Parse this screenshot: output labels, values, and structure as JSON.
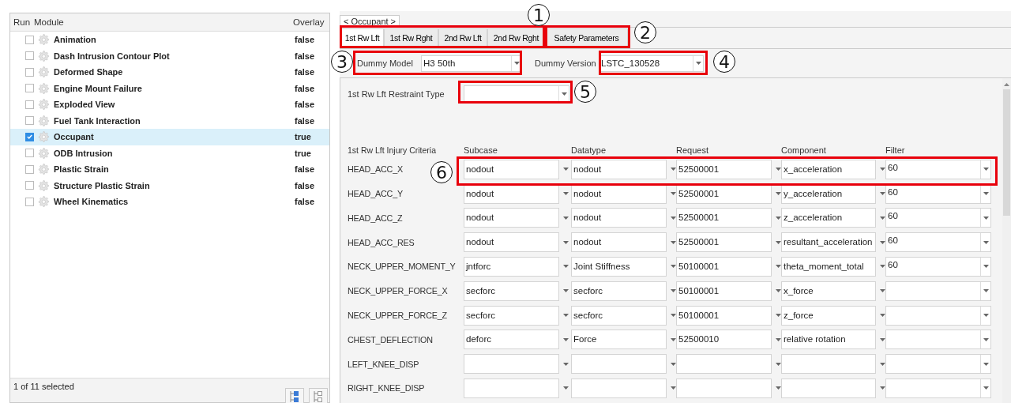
{
  "modules": {
    "columns": [
      "Run",
      "Module",
      "Overlay"
    ],
    "rows": [
      {
        "name": "Animation",
        "overlay": "false",
        "checked": false,
        "selected": false
      },
      {
        "name": "Dash Intrusion Contour Plot",
        "overlay": "false",
        "checked": false,
        "selected": false
      },
      {
        "name": "Deformed Shape",
        "overlay": "false",
        "checked": false,
        "selected": false
      },
      {
        "name": "Engine Mount Failure",
        "overlay": "false",
        "checked": false,
        "selected": false
      },
      {
        "name": "Exploded View",
        "overlay": "false",
        "checked": false,
        "selected": false
      },
      {
        "name": "Fuel Tank Interaction",
        "overlay": "false",
        "checked": false,
        "selected": false
      },
      {
        "name": "Occupant",
        "overlay": "true",
        "checked": true,
        "selected": true
      },
      {
        "name": "ODB Intrusion",
        "overlay": "true",
        "checked": false,
        "selected": false
      },
      {
        "name": "Plastic Strain",
        "overlay": "false",
        "checked": false,
        "selected": false
      },
      {
        "name": "Structure Plastic Strain",
        "overlay": "false",
        "checked": false,
        "selected": false
      },
      {
        "name": "Wheel Kinematics",
        "overlay": "false",
        "checked": false,
        "selected": false
      }
    ],
    "status": "1 of 11 selected"
  },
  "module_tab": "< Occupant >",
  "tabs": [
    {
      "label": "1st Rw Lft",
      "selected": true
    },
    {
      "label": "1st Rw Rght",
      "selected": false
    },
    {
      "label": "2nd Rw Lft",
      "selected": false
    },
    {
      "label": "2nd Rw Rght",
      "selected": false
    },
    {
      "label": "Safety Parameters",
      "selected": false
    }
  ],
  "dummy_model": {
    "label": "Dummy Model",
    "value": "H3 50th"
  },
  "dummy_version": {
    "label": "Dummy Version",
    "value": "LSTC_130528"
  },
  "restraint_type": {
    "label": "1st Rw Lft Restraint Type"
  },
  "criteria": {
    "title": "1st Rw Lft Injury Criteria",
    "columns": [
      "Subcase",
      "Datatype",
      "Request",
      "Component",
      "Filter"
    ],
    "rows": [
      {
        "name": "HEAD_ACC_X",
        "cells": [
          {
            "value": "nodout"
          },
          {
            "value": "nodout"
          },
          {
            "value": "52500001"
          },
          {
            "value": "x_acceleration"
          },
          {
            "value": "60"
          }
        ]
      },
      {
        "name": "HEAD_ACC_Y",
        "cells": [
          {
            "value": "nodout"
          },
          {
            "value": "nodout"
          },
          {
            "value": "52500001"
          },
          {
            "value": "y_acceleration"
          },
          {
            "value": "60"
          }
        ]
      },
      {
        "name": "HEAD_ACC_Z",
        "cells": [
          {
            "value": "nodout"
          },
          {
            "value": "nodout"
          },
          {
            "value": "52500001"
          },
          {
            "value": "z_acceleration"
          },
          {
            "value": "60"
          }
        ]
      },
      {
        "name": "HEAD_ACC_RES",
        "cells": [
          {
            "value": "nodout"
          },
          {
            "value": "nodout"
          },
          {
            "value": "52500001"
          },
          {
            "value": "resultant_acceleration"
          },
          {
            "value": "60"
          }
        ]
      },
      {
        "name": "NECK_UPPER_MOMENT_Y",
        "cells": [
          {
            "value": "jntforc"
          },
          {
            "value": "Joint Stiffness"
          },
          {
            "value": "50100001"
          },
          {
            "value": "theta_moment_total"
          },
          {
            "value": "60"
          }
        ]
      },
      {
        "name": "NECK_UPPER_FORCE_X",
        "cells": [
          {
            "value": "secforc"
          },
          {
            "value": "secforc"
          },
          {
            "value": "50100001"
          },
          {
            "value": "x_force"
          },
          {}
        ]
      },
      {
        "name": "NECK_UPPER_FORCE_Z",
        "cells": [
          {
            "value": "secforc"
          },
          {
            "value": "secforc"
          },
          {
            "value": "50100001"
          },
          {
            "value": "z_force"
          },
          {}
        ]
      },
      {
        "name": "CHEST_DEFLECTION",
        "cells": [
          {
            "value": "deforc"
          },
          {
            "value": "Force"
          },
          {
            "value": "52500010"
          },
          {
            "value": "relative rotation"
          },
          {}
        ]
      },
      {
        "name": "LEFT_KNEE_DISP",
        "cells": [
          {},
          {},
          {},
          {},
          {}
        ]
      },
      {
        "name": "RIGHT_KNEE_DISP",
        "cells": [
          {},
          {},
          {},
          {},
          {}
        ]
      }
    ]
  },
  "callouts": [
    {
      "label": "1"
    },
    {
      "label": "2"
    },
    {
      "label": "3"
    },
    {
      "label": "4"
    },
    {
      "label": "5"
    },
    {
      "label": "6"
    }
  ]
}
